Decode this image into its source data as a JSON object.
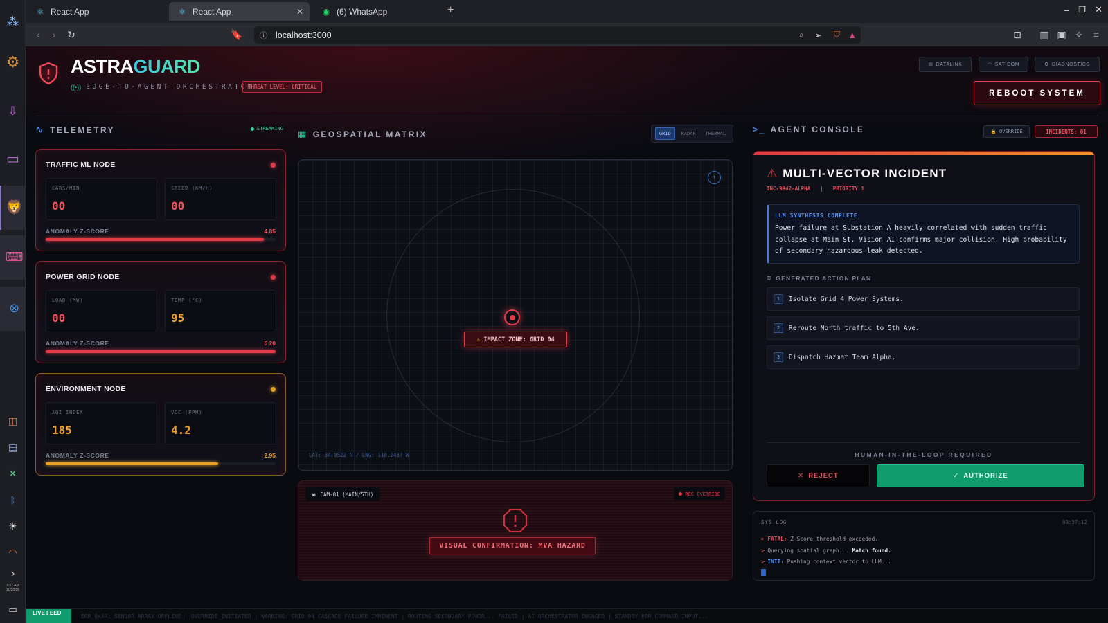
{
  "os": {
    "clock_time": "9:57 AM",
    "clock_date": "11/20/25"
  },
  "browser": {
    "tabs": [
      {
        "label": "React App",
        "icon": "react-icon",
        "active": false
      },
      {
        "label": "React App",
        "icon": "react-icon",
        "active": true
      },
      {
        "label": "(6) WhatsApp",
        "icon": "whatsapp-icon",
        "active": false
      }
    ],
    "url": "localhost:3000"
  },
  "header": {
    "brand_part1": "ASTRA",
    "brand_part2": "GUARD",
    "subtitle": "EDGE-TO-AGENT ORCHESTRATOR",
    "threat_badge": "THREAT LEVEL: CRITICAL",
    "buttons": {
      "datalink": "DATALINK",
      "satcom": "SAT-COM",
      "diagnostics": "DIAGNOSTICS"
    },
    "reboot": "REBOOT SYSTEM"
  },
  "telemetry": {
    "title": "TELEMETRY",
    "status": "STREAMING",
    "nodes": [
      {
        "name": "TRAFFIC ML NODE",
        "status_color": "#e03a48",
        "metrics": [
          {
            "label": "CARS/MIN",
            "value": "00"
          },
          {
            "label": "SPEED (KM/H)",
            "value": "00"
          }
        ],
        "z_label": "ANOMALY Z-SCORE",
        "z_value": "4.85",
        "z_fraction": 0.95
      },
      {
        "name": "POWER GRID NODE",
        "status_color": "#e03a48",
        "metrics": [
          {
            "label": "LOAD (MW)",
            "value": "00"
          },
          {
            "label": "TEMP (°C)",
            "value": "95"
          }
        ],
        "z_label": "ANOMALY Z-SCORE",
        "z_value": "5.20",
        "z_fraction": 1.0
      },
      {
        "name": "ENVIRONMENT NODE",
        "status_color": "#e8a020",
        "metrics": [
          {
            "label": "AQI INDEX",
            "value": "185"
          },
          {
            "label": "VOC (PPM)",
            "value": "4.2"
          }
        ],
        "z_label": "ANOMALY Z-SCORE",
        "z_value": "2.95",
        "z_fraction": 0.75
      }
    ]
  },
  "geo": {
    "title": "GEOSPATIAL MATRIX",
    "modes": [
      "GRID",
      "RADAR",
      "THERMAL"
    ],
    "active_mode": "GRID",
    "impact_label": "IMPACT ZONE: GRID 04",
    "coords": "LAT: 34.0522 N / LNG: 118.2437 W"
  },
  "camera": {
    "label": "CAM-01 (MAIN/5TH)",
    "rec": "REC OVERRIDE",
    "alert": "VISUAL CONFIRMATION: MVA HAZARD"
  },
  "console": {
    "title": "AGENT CONSOLE",
    "override": "OVERRIDE",
    "incidents": "INCIDENTS: 01",
    "incident_title": "MULTI-VECTOR INCIDENT",
    "incident_id": "INC-9942-ALPHA",
    "separator": "|",
    "priority": "PRIORITY 1",
    "synthesis_title": "LLM SYNTHESIS COMPLETE",
    "synthesis_text": "Power failure at Substation A heavily correlated with sudden traffic collapse at Main St. Vision AI confirms major collision. High probability of secondary hazardous leak detected.",
    "plan_title": "GENERATED ACTION PLAN",
    "steps": [
      {
        "n": "1",
        "text": "Isolate Grid 4 Power Systems."
      },
      {
        "n": "2",
        "text": "Reroute North traffic to 5th Ave."
      },
      {
        "n": "3",
        "text": "Dispatch Hazmat Team Alpha."
      }
    ],
    "hitl": "HUMAN-IN-THE-LOOP REQUIRED",
    "reject": "REJECT",
    "authorize": "AUTHORIZE"
  },
  "syslog": {
    "title": "SYS_LOG",
    "time": "09:37:12",
    "lines": [
      {
        "prefix": "> ",
        "tag": "FATAL:",
        "text": " Z-Score threshold exceeded.",
        "strong": ""
      },
      {
        "prefix": "> ",
        "tag": "",
        "text": "Querying spatial graph... ",
        "strong": "Match found."
      },
      {
        "prefix": "> ",
        "tag": "INIT:",
        "text": " Pushing context vector to LLM...",
        "strong": ""
      }
    ]
  },
  "ticker": {
    "label": "LIVE FEED",
    "text": "ERR_0x44: SENSOR ARRAY OFFLINE | OVERRIDE_INITIATED | WARNING: GRID 04 CASCADE FAILURE IMMINENT | ROUTING SECONDARY POWER... FAILED | AI ORCHESTRATOR ENGAGED | STANDBY FOR COMMAND INPUT..."
  },
  "colors": {
    "accent_red": "#e23b46",
    "accent_amber": "#e8a020",
    "brand_cyan": "#2ed3c8",
    "authorize_green": "#0f9b6c",
    "synthesis_blue": "#4a7bd8"
  }
}
